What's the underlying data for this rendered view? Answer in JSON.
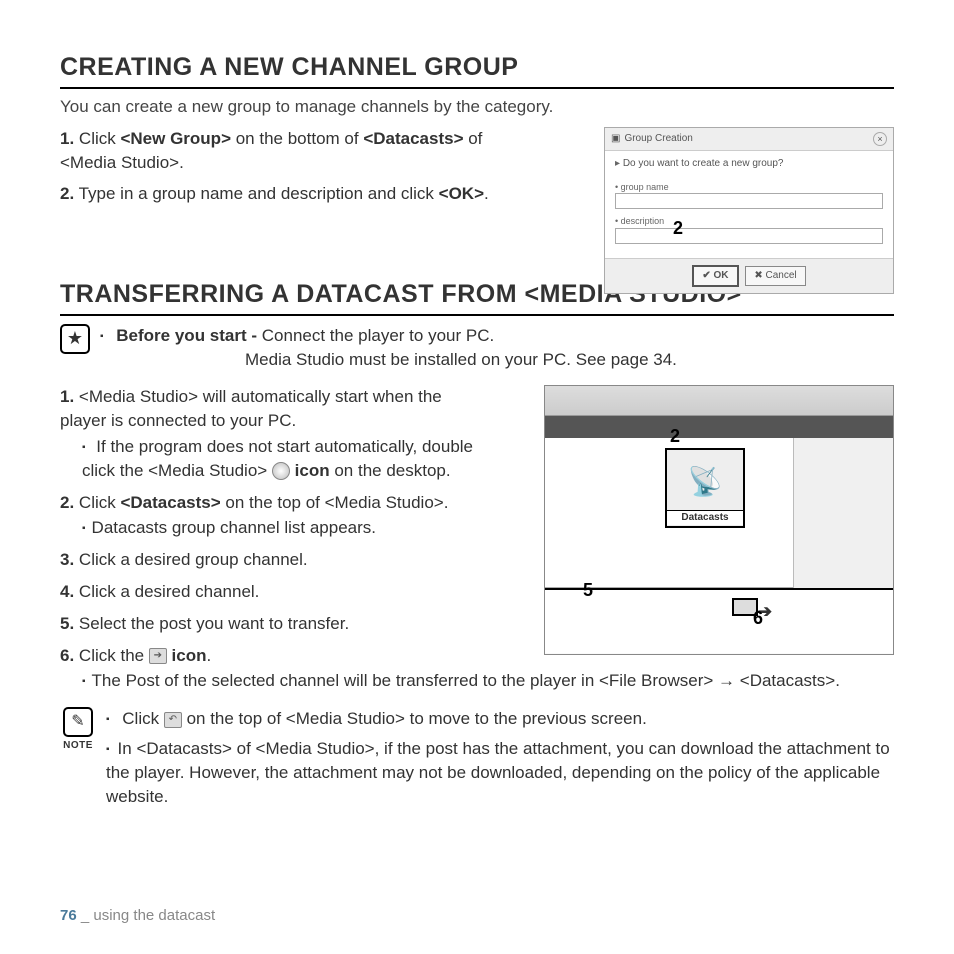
{
  "section1": {
    "heading": "CREATING A NEW CHANNEL GROUP",
    "intro": "You can create a new group to manage channels by the category.",
    "step1_num": "1.",
    "step1_a": " Click ",
    "step1_b": "<New Group>",
    "step1_c": " on the bottom of ",
    "step1_d": "<Datacasts>",
    "step1_e": " of <Media Studio>.",
    "step2_num": "2.",
    "step2_a": " Type in a group name and description and click ",
    "step2_b": "<OK>",
    "step2_c": "."
  },
  "dialog": {
    "title": "Group Creation",
    "question": "Do you want to create a new group?",
    "field1": "group name",
    "field2": "description",
    "ok": "OK",
    "cancel": "Cancel",
    "callout": "2"
  },
  "section2": {
    "heading": "TRANSFERRING A DATACAST FROM <MEDIA STUDIO>",
    "before_b": "Before you start -",
    "before_t1": " Connect the player to your PC.",
    "before_t2": "Media Studio must be installed on your PC. See page 34.",
    "s1_num": "1.",
    "s1_t": " <Media Studio> will automatically start when the player is connected to your PC.",
    "s1_sub_a": "If the program does not start automatically, double click the <Media Studio> ",
    "s1_sub_b": " icon",
    "s1_sub_c": " on the desktop.",
    "s2_num": "2.",
    "s2_a": " Click ",
    "s2_b": "<Datacasts>",
    "s2_c": " on the top of <Media Studio>.",
    "s2_sub": "Datacasts group channel list appears.",
    "s3_num": "3.",
    "s3_t": " Click a desired group channel.",
    "s4_num": "4.",
    "s4_t": " Click a desired channel.",
    "s5_num": "5.",
    "s5_t": " Select the post you want to transfer.",
    "s6_num": "6.",
    "s6_a": " Click the ",
    "s6_b": " icon",
    "s6_c": ".",
    "s6_sub": "The Post of the selected channel will be transferred to the player in <File Browser> → <Datacasts>."
  },
  "app": {
    "datacasts_label": "Datacasts",
    "c2": "2",
    "c5": "5",
    "c6": "6"
  },
  "note": {
    "label": "NOTE",
    "n1_a": "Click ",
    "n1_b": " on the top of <Media Studio> to move to the previous screen.",
    "n2": "In <Datacasts> of <Media Studio>, if the post has the attachment, you can download the attachment to the player. However, the attachment may not be downloaded, depending on the policy of the applicable website."
  },
  "footer": {
    "page": "76",
    "sep": " _ ",
    "section": "using the datacast"
  }
}
